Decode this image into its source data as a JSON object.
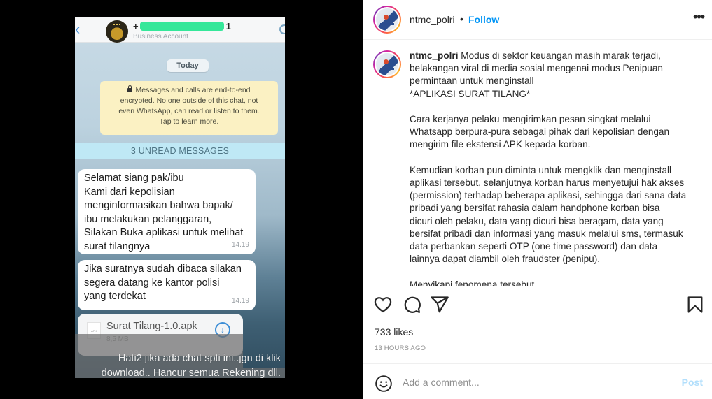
{
  "media": {
    "chat_header": {
      "contact_prefix": "+",
      "contact_suffix": "1",
      "subtitle": "Business Account",
      "back_icon": "chevron-left-icon",
      "call_icon": "phone-icon"
    },
    "date_chip": "Today",
    "encryption_notice": {
      "lines": [
        "Messages and calls are end-to-end",
        "encrypted. No one outside of this chat, not",
        "even WhatsApp, can read or listen to them.",
        "Tap to learn more."
      ],
      "icon": "lock-icon"
    },
    "unread_banner": "3 UNREAD MESSAGES",
    "messages": [
      {
        "lines": [
          "Selamat siang pak/ibu",
          "Kami dari kepolisian",
          "menginformasikan bahwa bapak/",
          "ibu melakukan pelanggaran,",
          "Silakan Buka aplikasi untuk melihat",
          "surat tilangnya"
        ],
        "time": "14.19"
      },
      {
        "lines": [
          "Jika suratnya sudah dibaca silakan",
          "segera datang ke kantor polisi",
          "yang terdekat"
        ],
        "time": "14.19"
      }
    ],
    "file": {
      "icon_label": "APK",
      "name": "Surat Tilang-1.0.apk",
      "size": "8,5 MB",
      "download_icon": "download-icon"
    },
    "overlay_caption": {
      "line1": "Hati2 jika ada chat spti ini..jgn di klik",
      "line2": "download.. Hancur semua Rekening dll."
    }
  },
  "post": {
    "username": "ntmc_polri",
    "separator": "•",
    "follow_label": "Follow",
    "more_label": "•••",
    "caption": {
      "username": "ntmc_polri",
      "text": " Modus di sektor keuangan masih marak terjadi,\nbelakangan viral di media sosial mengenai modus Penipuan\npermintaan untuk menginstall\n*APLIKASI SURAT TILANG*\n\nCara kerjanya pelaku mengirimkan pesan singkat melalui\nWhatsapp berpura-pura sebagai pihak dari kepolisian dengan\nmengirim file ekstensi APK kepada korban.\n\nKemudian korban pun diminta untuk mengklik dan menginstall\naplikasi tersebut, selanjutnya korban harus menyetujui hak akses\n(permission) terhadap beberapa aplikasi, sehingga dari sana data\npribadi yang bersifat rahasia dalam handphone korban bisa\ndicuri oleh pelaku, data yang dicuri bisa beragam, data yang\nbersifat pribadi dan informasi yang masuk melalui sms, termasuk\ndata perbankan seperti OTP (one time password) dan data\nlainnya dapat diambil oleh fraudster (penipu).\n\nMenyikapi fenomena tersebut"
    },
    "actions": {
      "like_icon": "heart-icon",
      "comment_icon": "comment-icon",
      "share_icon": "send-icon",
      "save_icon": "bookmark-icon"
    },
    "likes": "733 likes",
    "timestamp": "13 HOURS AGO",
    "comment": {
      "placeholder": "Add a comment...",
      "value": "",
      "post_label": "Post",
      "emoji_icon": "emoji-icon"
    }
  },
  "colors": {
    "follow_blue": "#0095f6",
    "post_disabled": "#b2dffc",
    "redaction_green": "#35e79a"
  }
}
